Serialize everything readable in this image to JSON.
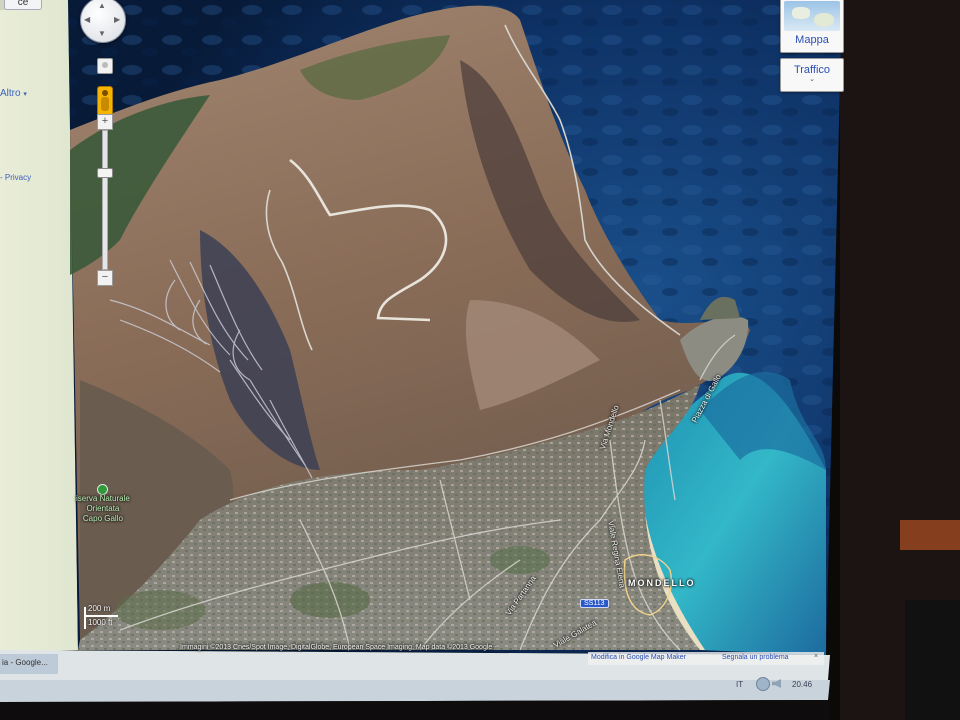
{
  "browser": {
    "top_tab_fragment": "ce",
    "taskbar_tab": "ia - Google..."
  },
  "sidebar": {
    "more_link": "Altro",
    "privacy_link": "- Privacy"
  },
  "map_controls": {
    "map_button": "Mappa",
    "traffic_button": "Traffico"
  },
  "map_labels": {
    "reserve_line1": "iserva Naturale",
    "reserve_line2": "Orientata",
    "reserve_line3": "Capo Gallo",
    "town": "MONDELLO",
    "road_mondello": "Via Mondello",
    "road_regina_elena": "Viale Regina Elena",
    "road_galatea": "Viale Galatea",
    "road_partanna": "Via Partanna",
    "road_sp": "SS113",
    "road_piazza": "Piazza di Gallo"
  },
  "scale": {
    "meters": "200 m",
    "feet": "1000 ft"
  },
  "attribution": "Immagini ©2013 Cnes/Spot Image, DigitalGlobe, European Space Imaging, Map data ©2013 Google -",
  "footer_links": {
    "edit_link": "Modifica in Google Map Maker",
    "report_link": "Segnala un problema"
  },
  "taskbar": {
    "lang": "IT",
    "clock": "20.46"
  },
  "colors": {
    "sea_deep": "#0d2f5e",
    "sea_shallow": "#1fa6b8",
    "terrain": "#8d6f58",
    "urban": "#7d7c73",
    "link_blue": "#2a4fb4"
  },
  "icons": {
    "pan": "pan-control-icon",
    "pegman": "pegman-icon",
    "zoom_in": "zoom-in-icon",
    "zoom_out": "zoom-out-icon",
    "globe": "satellite-globe-icon",
    "reserve_marker": "green-park-marker-icon"
  }
}
